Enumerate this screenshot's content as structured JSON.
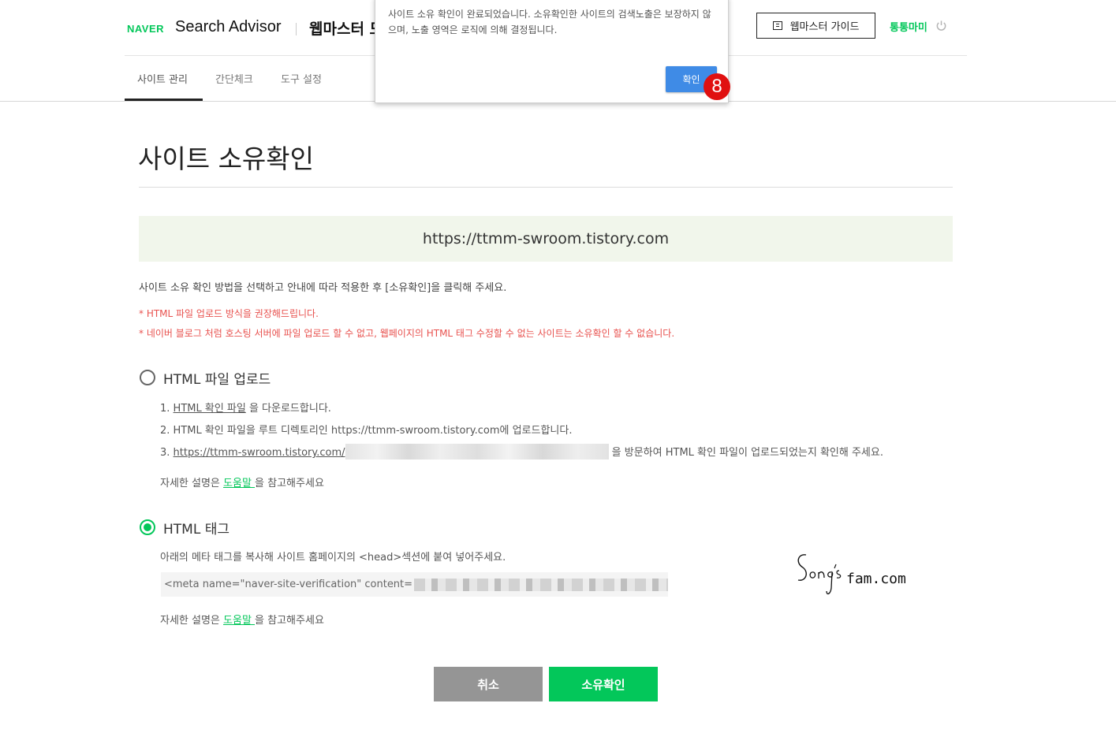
{
  "header": {
    "brand": "NAVER",
    "product": "Search Advisor",
    "section_title": "웹마스터 도",
    "guide_button": "웹마스터 가이드",
    "user_name": "통통마미",
    "tabs": [
      {
        "label": "사이트 관리",
        "active": true
      },
      {
        "label": "간단체크",
        "active": false
      },
      {
        "label": "도구 설정",
        "active": false
      }
    ]
  },
  "dialog": {
    "message": "사이트 소유 확인이 완료되었습니다. 소유확인한 사이트의 검색노출은 보장하지 않으며, 노출 영역은 로직에 의해 결정됩니다.",
    "ok_label": "확인",
    "step_number": "8"
  },
  "main": {
    "title": "사이트 소유확인",
    "site_url": "https://ttmm-swroom.tistory.com",
    "instruction": "사이트 소유 확인 방법을 선택하고 안내에 따라 적용한 후 [소유확인]을 클릭해 주세요.",
    "notices": [
      "* HTML 파일 업로드 방식을 권장해드립니다.",
      "* 네이버 블로그 처럼 호스팅 서버에 파일 업로드 할 수 없고, 웹페이지의 HTML 태그 수정할 수 없는 사이트는 소유확인 할 수 없습니다."
    ]
  },
  "option_html_file": {
    "label": "HTML 파일 업로드",
    "selected": false,
    "step1_prefix": "1. ",
    "step1_link": "HTML 확인 파일",
    "step1_suffix": " 을 다운로드합니다.",
    "step2": "2. HTML 확인 파일을 루트 디렉토리인 https://ttmm-swroom.tistory.com에 업로드합니다.",
    "step3_prefix": "3. ",
    "step3_link": "https://ttmm-swroom.tistory.com/",
    "step3_suffix": " 을 방문하여 HTML 확인 파일이 업로드되었는지 확인해 주세요.",
    "help_prefix": "자세한 설명은 ",
    "help_link": "도움말 ",
    "help_suffix": "을 참고해주세요"
  },
  "option_html_tag": {
    "label": "HTML 태그",
    "selected": true,
    "description": "아래의 메타 태그를 복사해 사이트 홈페이지의 <head>섹션에 붙여 넣어주세요.",
    "meta_prefix": "<meta name=\"naver-site-verification\" content=",
    "help_prefix": "자세한 설명은 ",
    "help_link": "도움말 ",
    "help_suffix": "을 참고해주세요"
  },
  "watermark": {
    "text": "fam.com"
  },
  "actions": {
    "cancel": "취소",
    "confirm": "소유확인"
  },
  "colors": {
    "naver_green": "#03c75a",
    "notice_red": "#e8514e",
    "dialog_button": "#3f8be6",
    "cancel_gray": "#959595",
    "url_box_bg": "#f1f6eb"
  }
}
